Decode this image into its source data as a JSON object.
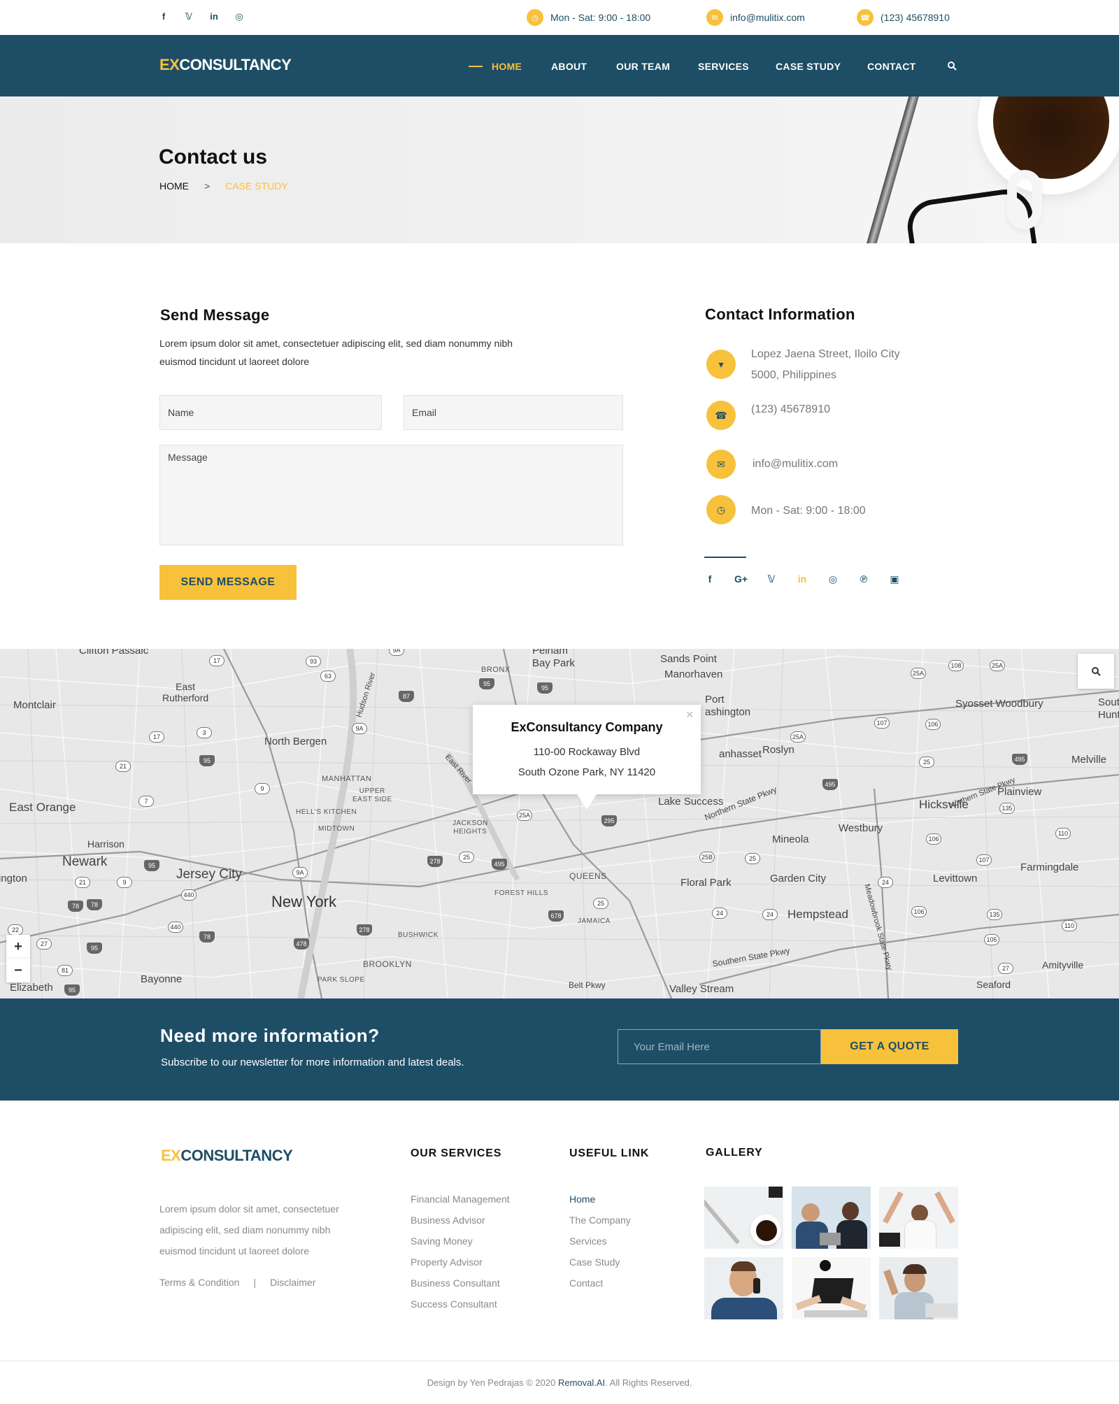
{
  "topbar": {
    "socials": [
      "facebook-icon",
      "twitter-icon",
      "linkedin-icon",
      "dribbble-icon"
    ],
    "hours": "Mon - Sat: 9:00 - 18:00",
    "email": "info@mulitix.com",
    "phone": "(123) 45678910"
  },
  "brand": {
    "prefix": "EX",
    "rest": "CONSULTANCY"
  },
  "nav": {
    "items": [
      "HOME",
      "ABOUT",
      "OUR TEAM",
      "SERVICES",
      "CASE STUDY",
      "CONTACT"
    ],
    "active": "HOME"
  },
  "hero": {
    "title": "Contact us",
    "breadcrumb": {
      "home": "HOME",
      "separator": ">",
      "current": "CASE STUDY"
    }
  },
  "form": {
    "title": "Send Message",
    "intro": "Lorem ipsum dolor sit amet, consectetuer adipiscing elit, sed diam nonummy nibh euismod tincidunt ut laoreet dolore",
    "name_placeholder": "Name",
    "email_placeholder": "Email",
    "message_placeholder": "Message",
    "submit": "SEND MESSAGE"
  },
  "contact_info": {
    "title": "Contact Information",
    "address_line1": "Lopez Jaena Street, Iloilo City",
    "address_line2": "5000, Philippines",
    "phone": "(123) 45678910",
    "email": "info@mulitix.com",
    "hours": "Mon - Sat: 9:00 - 18:00",
    "socials": [
      "facebook-icon",
      "google-plus-icon",
      "twitter-icon",
      "linkedin-icon",
      "dribbble-icon",
      "pinterest-icon",
      "instagram-icon"
    ]
  },
  "map": {
    "popup": {
      "title": "ExConsultancy Company",
      "line1": "110-00 Rockaway Blvd",
      "line2": "South Ozone Park, NY 11420"
    },
    "zoom_in": "+",
    "zoom_out": "−",
    "labels": {
      "clifton_passaic": "Clifton  Passaic",
      "pelham_bay": "Pelham\nBay Park",
      "sands_point": "Sands Point",
      "manorhaven": "Manorhaven",
      "port_washington": "Port\nashington",
      "syosset": "Syosset Woodbury",
      "south_huntington": "Sout\nHunting",
      "montclair": "Montclair",
      "east_rutherford": "East\nRutherford",
      "north_bergen": "North Bergen",
      "bronx": "BRONX",
      "manhasset": "anhasset",
      "roslyn": "Roslyn",
      "melville": "Melville",
      "plainview": "Plainview",
      "hicksville": "Hicksville",
      "east_orange": "East Orange",
      "manhattan": "MANHATTAN",
      "upper_east_side": "UPPER\nEAST SIDE",
      "hells_kitchen": "HELL'S KITCHEN",
      "midtown": "MIDTOWN",
      "jackson_heights": "JACKSON\nHEIGHTS",
      "lake_success": "Lake Success",
      "westbury": "Westbury",
      "mineola": "Mineola",
      "harrison": "Harrison",
      "newark": "Newark",
      "jersey_city": "Jersey City",
      "queens": "QUEENS",
      "floral_park": "Floral Park",
      "garden_city": "Garden City",
      "levittown": "Levittown",
      "farmingdale": "Farmingdale",
      "irvington": "ington",
      "new_york": "New York",
      "forest_hills": "FOREST HILLS",
      "hempstead": "Hempstead",
      "jamaica": "JAMAICA",
      "bushwick": "BUSHWICK",
      "brooklyn": "BROOKLYN",
      "bayonne": "Bayonne",
      "park_slope": "PARK SLOPE",
      "elizabeth": "Elizabeth",
      "belt_pkwy": "Belt Pkwy",
      "valley_stream": "Valley Stream",
      "amityville": "Amityville",
      "seaford": "Seaford",
      "southern_state": "Southern State Pkwy",
      "northern_state": "Northern State Pkwy",
      "meadowbrook": "Meadowbrook State Pkwy",
      "hudson_river": "Hudson River",
      "east_river": "East River"
    },
    "shields": [
      "17",
      "93",
      "63",
      "9A",
      "95",
      "95",
      "25A",
      "108",
      "25A",
      "17",
      "3",
      "95",
      "21",
      "9",
      "9A",
      "107",
      "106",
      "25A",
      "495",
      "25",
      "7",
      "25A",
      "295",
      "495",
      "135",
      "106",
      "110",
      "95",
      "278",
      "25",
      "495",
      "25B",
      "25",
      "107",
      "21",
      "9",
      "440",
      "78",
      "78",
      "9A",
      "25",
      "24",
      "440",
      "78",
      "278",
      "478",
      "678",
      "24",
      "24",
      "106",
      "135",
      "110",
      "22",
      "27",
      "95",
      "81",
      "105",
      "27",
      "95",
      "87"
    ]
  },
  "newsletter": {
    "title": "Need more information?",
    "subtitle": "Subscribe to our newsletter for more information and latest deals.",
    "placeholder": "Your Email Here",
    "button": "GET A QUOTE"
  },
  "footer": {
    "about": "Lorem ipsum dolor sit amet, consectetuer adipiscing elit, sed diam nonummy nibh euismod tincidunt ut laoreet dolore",
    "terms": "Terms & Condition",
    "legal_separator": "|",
    "disclaimer": "Disclaimer",
    "services_title": "OUR SERVICES",
    "services": [
      "Financial Management",
      "Business Advisor",
      "Saving Money",
      "Property Advisor",
      "Business Consultant",
      "Success Consultant"
    ],
    "links_title": "USEFUL LINK",
    "links": [
      "Home",
      "The Company",
      "Services",
      "Case Study",
      "Contact"
    ],
    "gallery_title": "GALLERY",
    "copyright_prefix": "Design by Yen Pedrajas © 2020 ",
    "copyright_brand": "Removal.AI",
    "copyright_suffix": ". All Rights Reserved."
  },
  "colors": {
    "primary": "#1d4e66",
    "accent": "#f7c13c"
  }
}
